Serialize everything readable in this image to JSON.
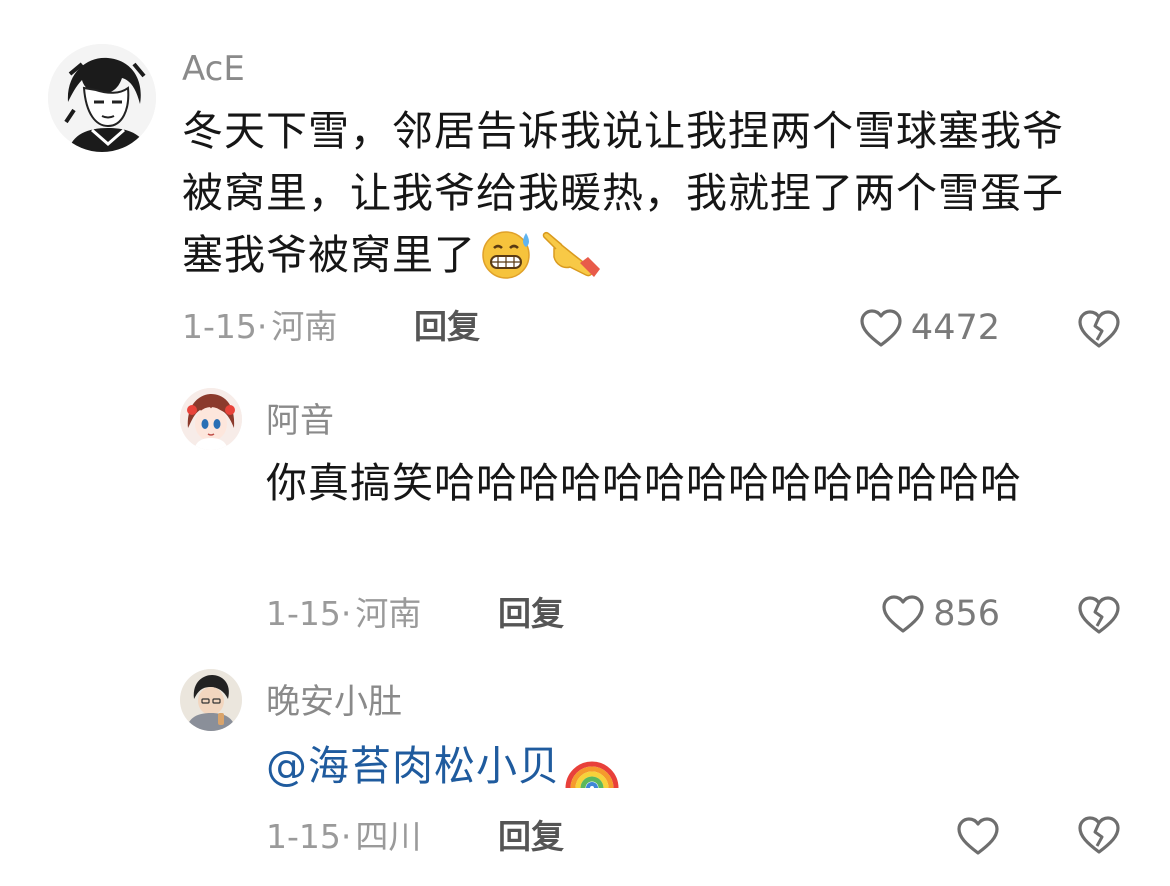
{
  "comments": [
    {
      "username": "AcE",
      "text": "冬天下雪，邻居告诉我说让我捏两个雪球塞我爷被窝里，让我爷给我暖热，我就捏了两个雪蛋子塞我爷被窝里了",
      "emojis": [
        "grinning-sweat-emoji",
        "pointing-hand-emoji"
      ],
      "date": "1-15",
      "location": "河南",
      "reply_label": "回复",
      "likes": "4472"
    },
    {
      "username": "阿音",
      "text": "你真搞笑哈哈哈哈哈哈哈哈哈哈哈哈哈哈",
      "date": "1-15",
      "location": "河南",
      "reply_label": "回复",
      "likes": "856"
    },
    {
      "username": "晚安小肚",
      "mention": "@海苔肉松小贝",
      "emojis": [
        "rainbow-emoji"
      ],
      "date": "1-15",
      "location": "四川",
      "reply_label": "回复",
      "likes": ""
    }
  ],
  "meta_separator": "·",
  "colors": {
    "text": "#161616",
    "username": "#8a8a8a",
    "meta": "#9a9a9a",
    "mention": "#1f5b9e",
    "icon": "#6e6e6e"
  },
  "icons": {
    "like": "heart-outline-icon",
    "dislike": "broken-heart-icon"
  }
}
